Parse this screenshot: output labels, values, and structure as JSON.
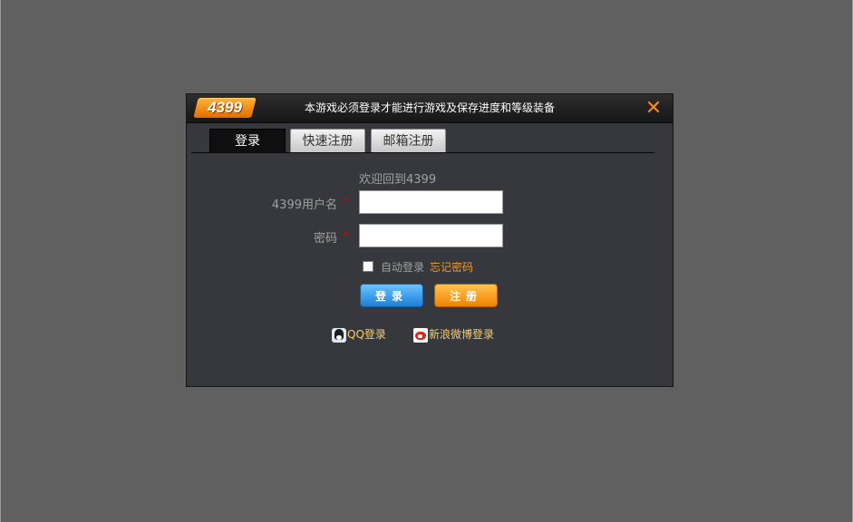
{
  "dialog": {
    "logo": "4399",
    "title": "本游戏必须登录才能进行游戏及保存进度和等级装备",
    "close_icon": "close-icon"
  },
  "tabs": [
    {
      "label": "登录",
      "active": true
    },
    {
      "label": "快速注册",
      "active": false
    },
    {
      "label": "邮箱注册",
      "active": false
    }
  ],
  "form": {
    "welcome": "欢迎回到4399",
    "username_label": "4399用户名",
    "password_label": "密码",
    "required_mark": "*",
    "username_value": "",
    "password_value": "",
    "auto_login_label": "自动登录",
    "auto_login_checked": false,
    "forgot_password": "忘记密码",
    "login_button": "登录",
    "register_button": "注册"
  },
  "third_party": {
    "qq_label": "QQ登录",
    "qq_icon": "qq-icon",
    "weibo_label": "新浪微博登录",
    "weibo_icon": "weibo-icon"
  },
  "colors": {
    "background": "#606060",
    "dialog": "#37383d",
    "accent_orange": "#f39a1e",
    "login_blue": "#1e7fd8",
    "required_red": "#d40000"
  }
}
